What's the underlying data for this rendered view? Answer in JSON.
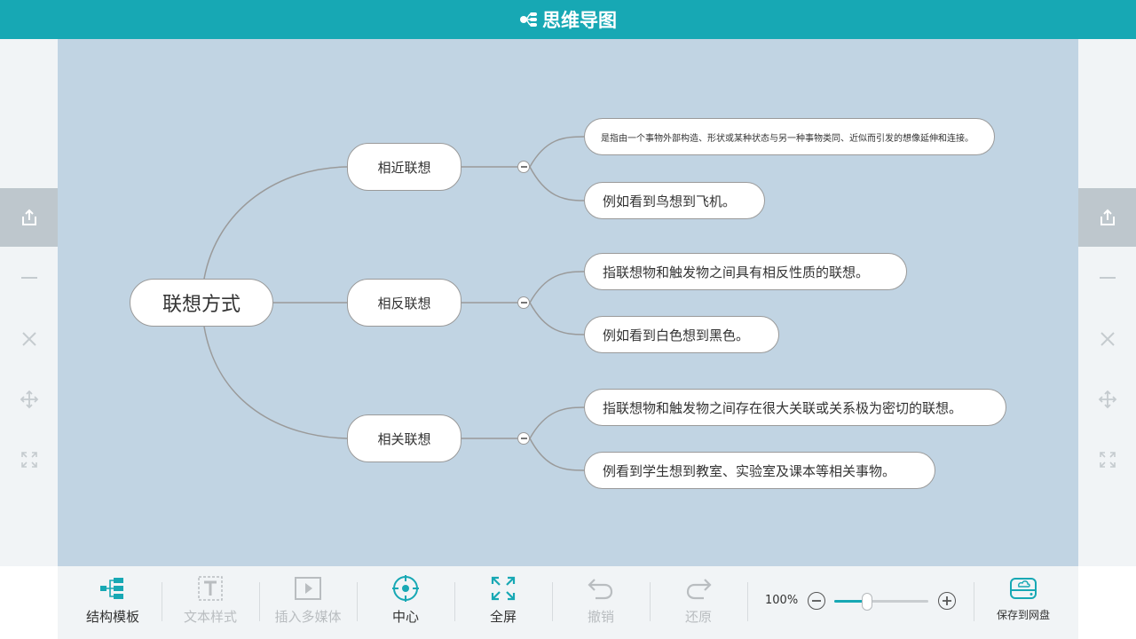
{
  "header": {
    "title": "思维导图",
    "logo_icon": "mindmap-logo-icon"
  },
  "colors": {
    "accent": "#17a8b4",
    "canvas": "#c1d4e3",
    "line": "#9a9a9a"
  },
  "mindmap": {
    "root": "联想方式",
    "branches": [
      {
        "label": "相近联想",
        "children": [
          "是指由一个事物外部构造、形状或某种状态与另一种事物类同、近似而引发的想像延伸和连接。",
          "例如看到鸟想到飞机。"
        ]
      },
      {
        "label": "相反联想",
        "children": [
          "指联想物和触发物之间具有相反性质的联想。",
          "例如看到白色想到黑色。"
        ]
      },
      {
        "label": "相关联想",
        "children": [
          "指联想物和触发物之间存在很大关联或关系极为密切的联想。",
          "例看到学生想到教室、实验室及课本等相关事物。"
        ]
      }
    ]
  },
  "side_tools": [
    "share-icon",
    "minimize-icon",
    "close-icon",
    "move-icon",
    "fullscreen-icon"
  ],
  "toolbar": {
    "structure": "结构模板",
    "text_style": "文本样式",
    "insert_media": "插入多媒体",
    "center": "中心",
    "fullscreen": "全屏",
    "undo": "撤销",
    "redo": "还原",
    "zoom": "100%",
    "zoom_level": 0.35,
    "save": "保存到网盘"
  }
}
